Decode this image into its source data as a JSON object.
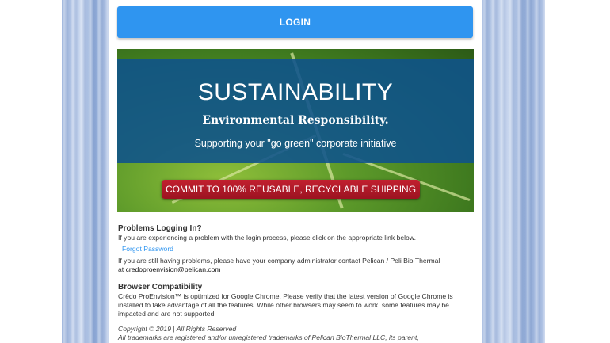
{
  "login": {
    "label": "LOGIN"
  },
  "banner": {
    "title": "SUSTAINABILITY",
    "subtitle": "Environmental Responsibility.",
    "tagline": "Supporting your \"go green\" corporate initiative",
    "ribbon": "COMMIT TO 100% REUSABLE, RECYCLABLE SHIPPING"
  },
  "problems": {
    "heading": "Problems Logging In?",
    "text": "If you are experiencing a problem with the login process, please click on the appropriate link below.",
    "forgot_link": "Forgot Password",
    "still_text": "If you are still having problems, please have your company administrator contact Pelican / Peli Bio Thermal",
    "at_prefix": "at",
    "email": "credoproenvision@pelican.com"
  },
  "compat": {
    "heading": "Browser Compatibility",
    "text": "Crēdo ProEnvision™ is optimized for Google Chrome. Please verify that the latest version of Google Chrome is installed to take advantage of all the features. While other browsers may seem to work, some features may be impacted and are not supported"
  },
  "footer": {
    "copyright": "Copyright © 2019 | All Rights Reserved",
    "trademarks": "All trademarks are registered and/or unregistered trademarks of Pelican BioThermal LLC, its parent,"
  }
}
